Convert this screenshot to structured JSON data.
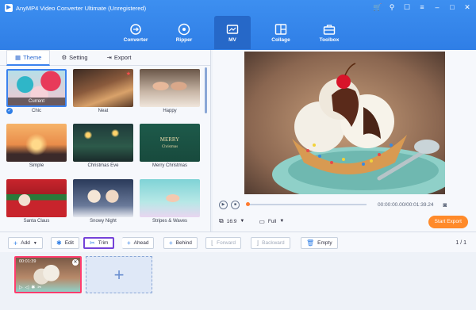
{
  "app": {
    "title": "AnyMP4 Video Converter Ultimate (Unregistered)"
  },
  "nav": [
    {
      "label": "Converter",
      "icon": "converter-icon",
      "active": false
    },
    {
      "label": "Ripper",
      "icon": "ripper-icon",
      "active": false
    },
    {
      "label": "MV",
      "icon": "mv-icon",
      "active": true
    },
    {
      "label": "Collage",
      "icon": "collage-icon",
      "active": false
    },
    {
      "label": "Toolbox",
      "icon": "toolbox-icon",
      "active": false
    }
  ],
  "tabs": [
    {
      "label": "Theme",
      "icon": "theme-icon",
      "active": true
    },
    {
      "label": "Setting",
      "icon": "gear-icon",
      "active": false
    },
    {
      "label": "Export",
      "icon": "export-icon",
      "active": false
    }
  ],
  "themes": [
    {
      "name": "Chic",
      "badge": "Current",
      "selected": true
    },
    {
      "name": "Neat"
    },
    {
      "name": "Happy"
    },
    {
      "name": "Simple"
    },
    {
      "name": "Christmas Eve"
    },
    {
      "name": "Merry Christmas"
    },
    {
      "name": "Santa Claus"
    },
    {
      "name": "Snowy Night"
    },
    {
      "name": "Stripes & Waves"
    }
  ],
  "preview": {
    "time": "00:00:00.00/00:01:39.24",
    "aspect": "16:9",
    "fit": "Full",
    "export_label": "Start Export",
    "progress": 0
  },
  "toolbar": {
    "add": "Add",
    "edit": "Edit",
    "trim": "Trim",
    "ahead": "Ahead",
    "behind": "Behind",
    "forward": "Forward",
    "backward": "Backward",
    "empty": "Empty",
    "step": "3",
    "page": "1 / 1"
  },
  "clip": {
    "time": "00:01:39"
  },
  "colors": {
    "accent": "#2f7ee6",
    "export": "#ff8a2a",
    "highlight": "#7442d8",
    "clip_border": "#ff3d6e"
  }
}
